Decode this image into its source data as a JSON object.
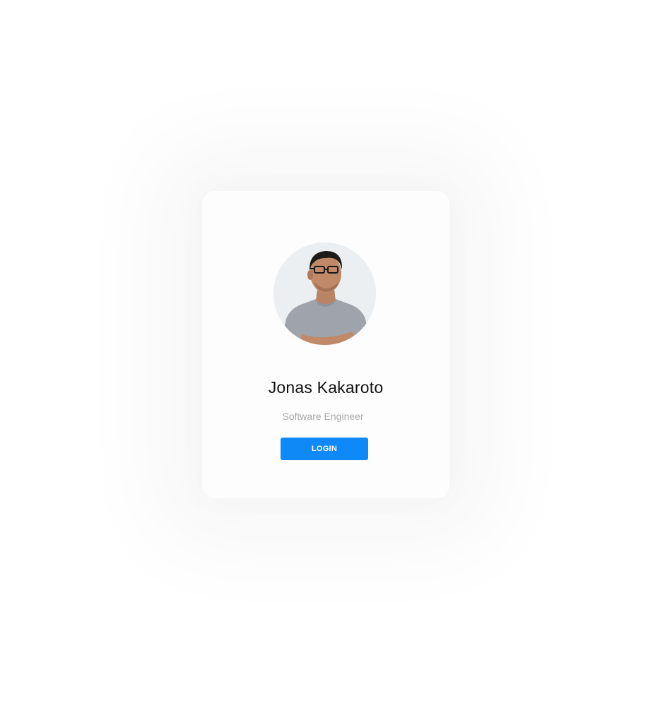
{
  "profile": {
    "name": "Jonas Kakaroto",
    "role": "Software Engineer",
    "avatar_icon": "user-photo"
  },
  "actions": {
    "login_label": "LOGIN"
  },
  "colors": {
    "accent": "#0f88f8",
    "subtitle": "#a9a9a9",
    "card_bg": "#fdfdfd"
  }
}
